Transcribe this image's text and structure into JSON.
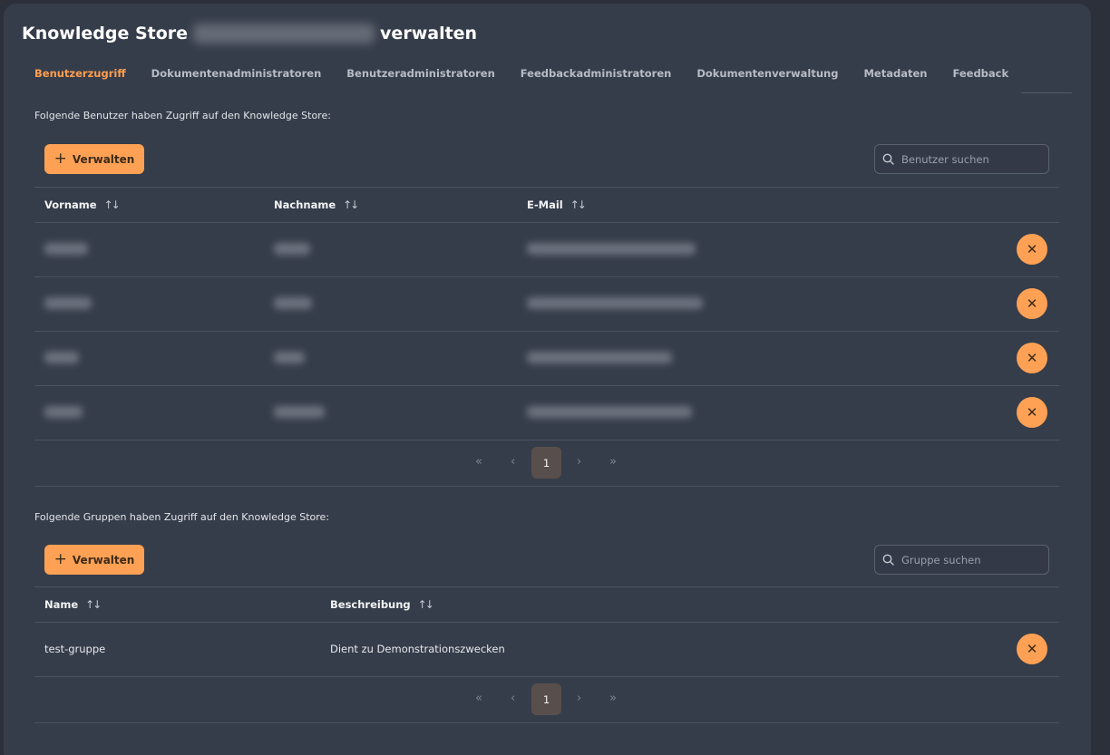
{
  "header": {
    "title_prefix": "Knowledge Store",
    "title_suffix": "verwalten"
  },
  "tabs": [
    {
      "label": "Benutzerzugriff",
      "active": true
    },
    {
      "label": "Dokumentenadministratoren",
      "active": false
    },
    {
      "label": "Benutzeradministratoren",
      "active": false
    },
    {
      "label": "Feedbackadministratoren",
      "active": false
    },
    {
      "label": "Dokumentenverwaltung",
      "active": false
    },
    {
      "label": "Metadaten",
      "active": false
    },
    {
      "label": "Feedback",
      "active": false
    }
  ],
  "users": {
    "intro": "Folgende Benutzer haben Zugriff auf den Knowledge Store:",
    "manage_label": "Verwalten",
    "search_placeholder": "Benutzer suchen",
    "columns": {
      "first": "Vorname",
      "last": "Nachname",
      "email": "E-Mail"
    },
    "row_count": 4,
    "pagination": {
      "current": "1",
      "first": "«",
      "prev": "‹",
      "next": "›",
      "last": "»"
    }
  },
  "groups": {
    "intro": "Folgende Gruppen haben Zugriff auf den Knowledge Store:",
    "manage_label": "Verwalten",
    "search_placeholder": "Gruppe suchen",
    "columns": {
      "name": "Name",
      "description": "Beschreibung"
    },
    "rows": [
      {
        "name": "test-gruppe",
        "description": "Dient zu Demonstrationszwecken"
      }
    ],
    "pagination": {
      "current": "1",
      "first": "«",
      "prev": "‹",
      "next": "›",
      "last": "»"
    }
  },
  "icons": {
    "plus": "+",
    "sort": "↑↓",
    "remove": "✕",
    "search": "search-icon"
  },
  "colors": {
    "accent": "#ffa155",
    "panel": "#363d4a",
    "background": "#2b303a"
  }
}
